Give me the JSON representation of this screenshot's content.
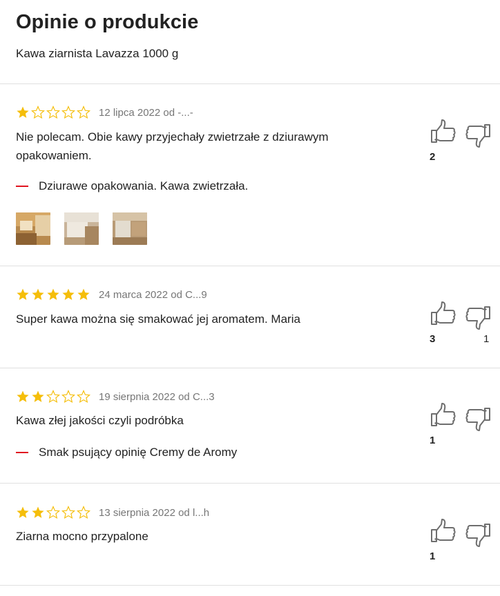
{
  "header": {
    "title": "Opinie o produkcie",
    "subtitle": "Kawa ziarnista Lavazza 1000 g"
  },
  "colors": {
    "star": "#f5be0b",
    "con_marker": "#e0131f",
    "divider": "#e0e0e0",
    "meta_text": "#767676"
  },
  "reviews": [
    {
      "rating": 1,
      "date": "12 lipca 2022 od -...-",
      "text": "Nie polecam. Obie kawy przyjechały zwietrzałe z dziurawym opakowaniem.",
      "con": "Dziurawe opakowania. Kawa zwietrzała.",
      "photos": [
        "photo-1",
        "photo-2",
        "photo-3"
      ],
      "helpful_yes": "2",
      "helpful_no": ""
    },
    {
      "rating": 5,
      "date": "24 marca 2022 od C...9",
      "text": "Super kawa można się smakować jej aromatem. Maria",
      "helpful_yes": "3",
      "helpful_no": "1"
    },
    {
      "rating": 2,
      "date": "19 sierpnia 2022 od C...3",
      "text": "Kawa złej jakości czyli podróbka",
      "con": "Smak psujący opinię Cremy de Aromy",
      "helpful_yes": "1",
      "helpful_no": ""
    },
    {
      "rating": 2,
      "date": "13 sierpnia 2022 od l...h",
      "text": "Ziarna mocno przypalone",
      "helpful_yes": "1",
      "helpful_no": ""
    }
  ],
  "icons": {
    "vote_up": "thumbs-up-icon",
    "vote_down": "thumbs-down-icon",
    "star": "star-icon",
    "con": "minus-icon"
  }
}
